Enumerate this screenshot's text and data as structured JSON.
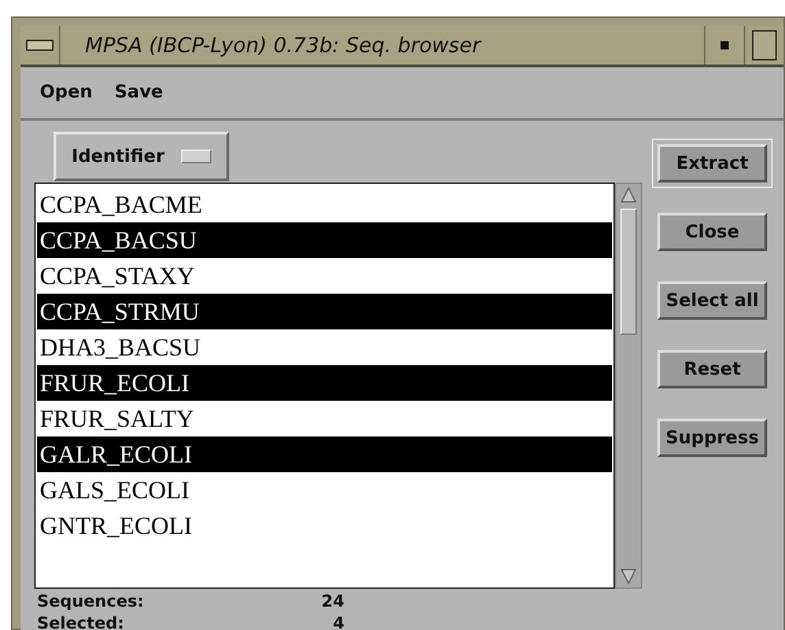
{
  "window": {
    "title": "MPSA (IBCP-Lyon) 0.73b: Seq. browser"
  },
  "menu": [
    "Open",
    "Save"
  ],
  "field_selector": {
    "value": "Identifier"
  },
  "sequences": [
    {
      "name": "CCPA_BACME",
      "selected": false
    },
    {
      "name": "CCPA_BACSU",
      "selected": true
    },
    {
      "name": "CCPA_STAXY",
      "selected": false
    },
    {
      "name": "CCPA_STRMU",
      "selected": true
    },
    {
      "name": "DHA3_BACSU",
      "selected": false
    },
    {
      "name": "FRUR_ECOLI",
      "selected": true
    },
    {
      "name": "FRUR_SALTY",
      "selected": false
    },
    {
      "name": "GALR_ECOLI",
      "selected": true
    },
    {
      "name": "GALS_ECOLI",
      "selected": false
    },
    {
      "name": "GNTR_ECOLI",
      "selected": false
    }
  ],
  "buttons": [
    {
      "label": "Extract",
      "default": true
    },
    {
      "label": "Close",
      "default": false
    },
    {
      "label": "Select all",
      "default": false
    },
    {
      "label": "Reset",
      "default": false
    },
    {
      "label": "Suppress",
      "default": false
    }
  ],
  "stats": [
    {
      "label": "Sequences:",
      "value": "24"
    },
    {
      "label": "Selected:",
      "value": "4"
    }
  ]
}
